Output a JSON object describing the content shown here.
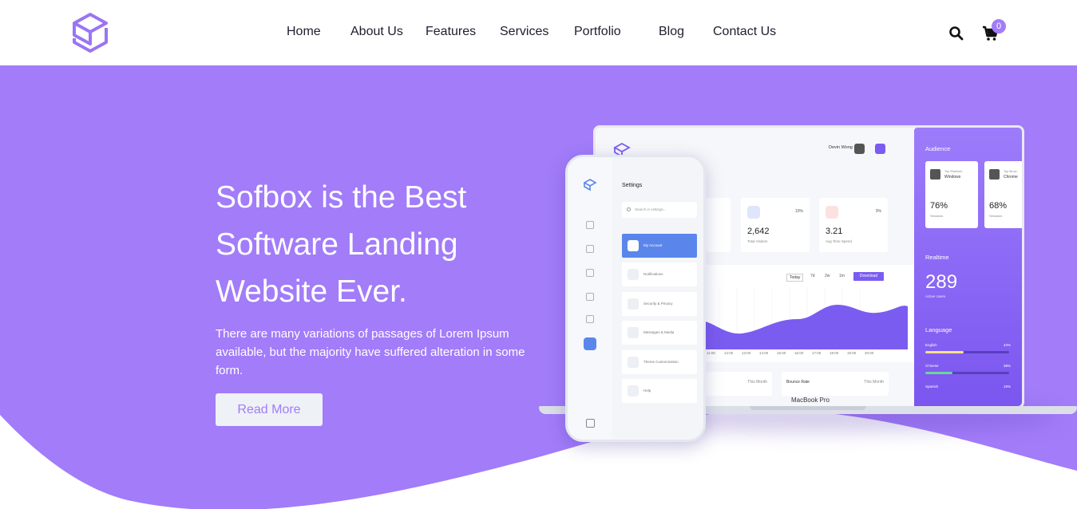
{
  "nav": {
    "items": [
      "Home",
      "About Us",
      "Features",
      "Services",
      "Portfolio",
      "Blog",
      "Contact Us"
    ]
  },
  "header": {
    "cart_count": "0",
    "search_icon": "search-icon",
    "cart_icon": "cart-icon"
  },
  "hero": {
    "title": "Sofbox is the Best Software Landing Website Ever.",
    "description": "There are many variations of passages of Lorem Ipsum available, but the majority have suffered alteration in some form.",
    "cta_label": "Read More"
  },
  "laptop": {
    "brand": "MacBook Pro",
    "user_name": "Devin Wong",
    "stats": [
      {
        "delta": "",
        "value": "",
        "label": ""
      },
      {
        "delta": "10%",
        "value": "2,642",
        "label": "Total Visitors"
      },
      {
        "delta": "3%",
        "value": "3.21",
        "label": "Avg Time Spend"
      }
    ],
    "chart": {
      "tabs": [
        "Today",
        "7d",
        "2w",
        "1m"
      ],
      "download_label": "Download",
      "x_ticks": [
        "11:00",
        "12:00",
        "13:00",
        "14:00",
        "15:00",
        "16:00",
        "17:00",
        "18:00",
        "19:00",
        "20:00"
      ]
    },
    "mini_cards": [
      {
        "title": "",
        "meta": "This Month"
      },
      {
        "title": "Bounce Rate",
        "meta": "This Month"
      }
    ],
    "audience": {
      "heading": "Audience",
      "cards": [
        {
          "top": "Top Platform",
          "name": "Windows",
          "percent": "76%",
          "sub": "Sessions"
        },
        {
          "top": "Top Brow",
          "name": "Chrome",
          "percent": "68%",
          "sub": "Sessions"
        }
      ]
    },
    "realtime": {
      "heading": "Realtime",
      "value": "289",
      "label": "Active Users"
    },
    "language": {
      "heading": "Language",
      "items": [
        {
          "name": "English",
          "percent": "43%",
          "color": "#ffe08a"
        },
        {
          "name": "Chinese",
          "percent": "38%",
          "color": "#6fd39a"
        },
        {
          "name": "Spanish",
          "percent": "19%",
          "color": "#ff8a8a"
        }
      ]
    }
  },
  "phone": {
    "title": "Settings",
    "search_placeholder": "Search in settings...",
    "menu": [
      {
        "label": "My Account",
        "active": true
      },
      {
        "label": "Notifications",
        "active": false
      },
      {
        "label": "Security & Privacy",
        "active": false
      },
      {
        "label": "Messages & Media",
        "active": false
      },
      {
        "label": "Theme Customization",
        "active": false
      },
      {
        "label": "Help",
        "active": false
      }
    ]
  },
  "colors": {
    "brand": "#a27cf9",
    "hero_bg": "#a27cf9",
    "accent_blue": "#5a86ec"
  }
}
